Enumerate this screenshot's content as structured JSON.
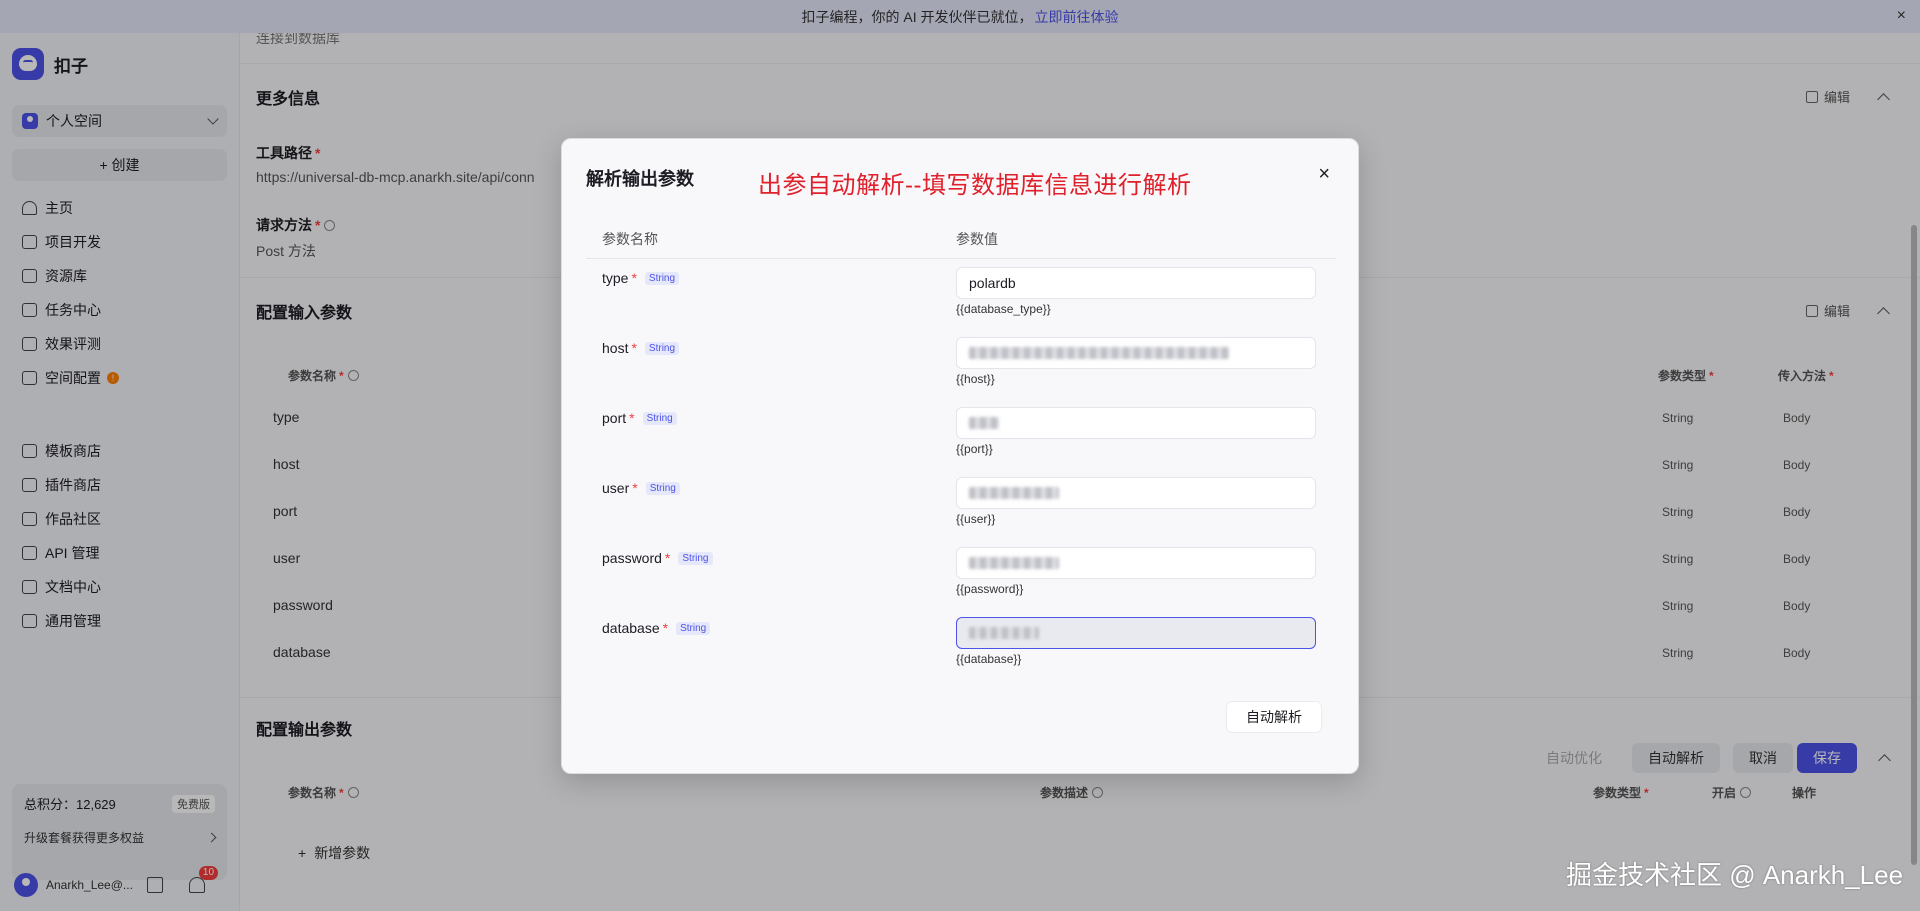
{
  "banner": {
    "text": "扣子编程，你的 AI 开发伙伴已就位，",
    "link": "立即前往体验",
    "close": "×"
  },
  "sidebar": {
    "app_name": "扣子",
    "space": "个人空间",
    "create": "+ 创建",
    "nav_primary": [
      {
        "label": "主页",
        "icon": "home-icon"
      },
      {
        "label": "项目开发",
        "icon": "project-icon"
      },
      {
        "label": "资源库",
        "icon": "library-icon"
      },
      {
        "label": "任务中心",
        "icon": "task-icon"
      },
      {
        "label": "效果评测",
        "icon": "evaluation-icon"
      },
      {
        "label": "空间配置",
        "icon": "space-config-icon",
        "badge": "!"
      }
    ],
    "nav_secondary": [
      {
        "label": "模板商店",
        "icon": "template-icon"
      },
      {
        "label": "插件商店",
        "icon": "plugin-icon"
      },
      {
        "label": "作品社区",
        "icon": "community-icon"
      },
      {
        "label": "API 管理",
        "icon": "api-icon"
      },
      {
        "label": "文档中心",
        "icon": "docs-icon"
      },
      {
        "label": "通用管理",
        "icon": "settings-icon"
      }
    ],
    "points": {
      "label": "总积分：12,629",
      "tag": "免费版",
      "upgrade": "升级套餐获得更多权益"
    },
    "user": {
      "name": "Anarkh_Lee@...",
      "notifications": "10"
    }
  },
  "main": {
    "top_text": "连接到数据库",
    "more_info": {
      "title": "更多信息",
      "edit": "编辑"
    },
    "tool_path": {
      "label": "工具路径",
      "value": "https://universal-db-mcp.anarkh.site/api/conn"
    },
    "method": {
      "label": "请求方法",
      "value": "Post 方法"
    },
    "input_params": {
      "title": "配置输入参数",
      "edit": "编辑",
      "headers": {
        "name": "参数名称",
        "type": "参数类型",
        "method": "传入方法"
      },
      "rows": [
        {
          "name": "type",
          "type": "String",
          "method": "Body"
        },
        {
          "name": "host",
          "type": "String",
          "method": "Body"
        },
        {
          "name": "port",
          "type": "String",
          "method": "Body"
        },
        {
          "name": "user",
          "type": "String",
          "method": "Body"
        },
        {
          "name": "password",
          "type": "String",
          "method": "Body"
        },
        {
          "name": "database",
          "type": "String",
          "method": "Body"
        }
      ]
    },
    "output_params": {
      "title": "配置输出参数",
      "auto_optimize": "自动优化",
      "auto_parse": "自动解析",
      "cancel": "取消",
      "save": "保存",
      "headers": {
        "name": "参数名称",
        "desc": "参数描述",
        "type": "参数类型",
        "enable": "开启",
        "ops": "操作"
      },
      "add": "新增参数"
    }
  },
  "modal": {
    "title": "解析输出参数",
    "annotation": "出参自动解析--填写数据库信息进行解析",
    "close": "×",
    "col_name": "参数名称",
    "col_value": "参数值",
    "rows": [
      {
        "name": "type",
        "type": "String",
        "value": "polardb",
        "hint": "{{database_type}}"
      },
      {
        "name": "host",
        "type": "String",
        "value": "",
        "hint": "{{host}}"
      },
      {
        "name": "port",
        "type": "String",
        "value": "",
        "hint": "{{port}}"
      },
      {
        "name": "user",
        "type": "String",
        "value": "",
        "hint": "{{user}}"
      },
      {
        "name": "password",
        "type": "String",
        "value": "",
        "hint": "{{password}}"
      },
      {
        "name": "database",
        "type": "String",
        "value": "",
        "hint": "{{database}}"
      }
    ],
    "auto_parse": "自动解析"
  },
  "watermark": "掘金技术社区 @ Anarkh_Lee"
}
